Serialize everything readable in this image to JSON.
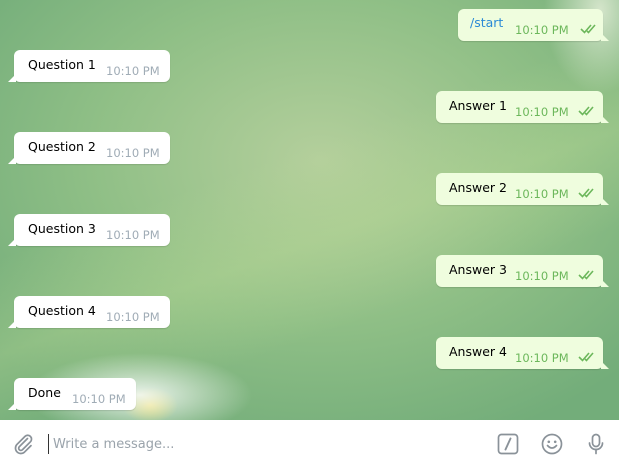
{
  "messages": [
    {
      "dir": "out",
      "text": "/start",
      "time": "10:10 PM",
      "is_command": true
    },
    {
      "dir": "in",
      "text": "Question 1",
      "time": "10:10 PM"
    },
    {
      "dir": "out",
      "text": "Answer 1",
      "time": "10:10 PM"
    },
    {
      "dir": "in",
      "text": "Question 2",
      "time": "10:10 PM"
    },
    {
      "dir": "out",
      "text": "Answer 2",
      "time": "10:10 PM"
    },
    {
      "dir": "in",
      "text": "Question 3",
      "time": "10:10 PM"
    },
    {
      "dir": "out",
      "text": "Answer 3",
      "time": "10:10 PM"
    },
    {
      "dir": "in",
      "text": "Question 4",
      "time": "10:10 PM"
    },
    {
      "dir": "out",
      "text": "Answer 4",
      "time": "10:10 PM"
    },
    {
      "dir": "in",
      "text": "Done",
      "time": "10:10 PM"
    }
  ],
  "composer": {
    "placeholder": "Write a message...",
    "value": "",
    "icons": [
      "paperclip-icon",
      "slash-command-icon",
      "emoji-icon",
      "microphone-icon"
    ]
  },
  "colors": {
    "incoming_bubble": "#ffffff",
    "outgoing_bubble": "#effdde",
    "outgoing_time": "#6cb75b",
    "incoming_time": "#a0acb6",
    "command_link": "#2b8ad6",
    "icon_gray": "#8a9299"
  }
}
